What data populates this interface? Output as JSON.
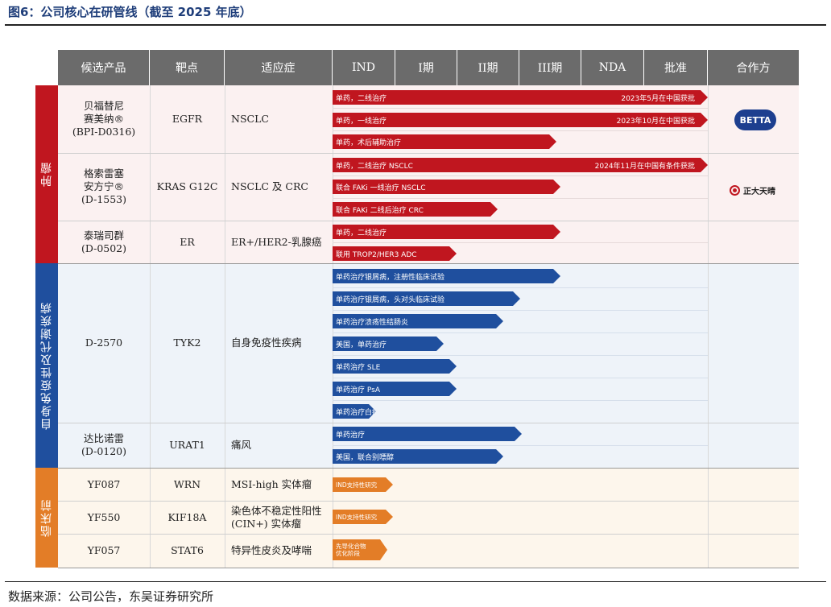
{
  "title": "图6：公司核心在研管线（截至 2025 年底）",
  "source": "数据来源：公司公告，东吴证券研究所",
  "headers": [
    "候选产品",
    "靶点",
    "适应症",
    "IND",
    "I期",
    "II期",
    "III期",
    "NDA",
    "批准",
    "合作方"
  ],
  "bands": {
    "oncology": "肿瘤",
    "autoimmune": "自身免疫性及代谢疾病",
    "preclinical": "临床前"
  },
  "colors": {
    "oncology": "#c0161f",
    "autoimmune": "#1f4f9e",
    "preclinical": "#e37d27"
  },
  "drugs": [
    {
      "name": "贝福替尼\n赛美纳®\n(BPI-D0316)",
      "target": "EGFR",
      "indication": "NSCLC"
    },
    {
      "name": "格索雷塞\n安方宁®\n(D-1553)",
      "target": "KRAS G12C",
      "indication": "NSCLC 及 CRC"
    },
    {
      "name": "泰瑞司群\n(D-0502)",
      "target": "ER",
      "indication": "ER+/HER2-乳腺癌"
    },
    {
      "name": "D-2570",
      "target": "TYK2",
      "indication": "自身免疫性疾病"
    },
    {
      "name": "达比诺雷\n(D-0120)",
      "target": "URAT1",
      "indication": "痛风"
    },
    {
      "name": "YF087",
      "target": "WRN",
      "indication": "MSI-high 实体瘤"
    },
    {
      "name": "YF550",
      "target": "KIF18A",
      "indication": "染色体不稳定性阳性\n(CIN+) 实体瘤"
    },
    {
      "name": "YF057",
      "target": "STAT6",
      "indication": "特异性皮炎及哮喘"
    }
  ],
  "bars": [
    {
      "label": "单药，二线治疗",
      "note": "2023年5月在中国获批",
      "color": "red"
    },
    {
      "label": "单药，一线治疗",
      "note": "2023年10月在中国获批",
      "color": "red"
    },
    {
      "label": "单药，术后辅助治疗",
      "note": "",
      "color": "red"
    },
    {
      "label": "单药，二线治疗 NSCLC",
      "note": "2024年11月在中国有条件获批",
      "color": "red"
    },
    {
      "label": "联合 FAKi 一线治疗 NSCLC",
      "note": "",
      "color": "red"
    },
    {
      "label": "联合 FAKi 二线后治疗 CRC",
      "note": "",
      "color": "red"
    },
    {
      "label": "单药，二线治疗",
      "note": "",
      "color": "red"
    },
    {
      "label": "联用 TROP2/HER3 ADC",
      "note": "",
      "color": "red"
    },
    {
      "label": "单药治疗银屑病，注册性临床试验",
      "note": "",
      "color": "blue"
    },
    {
      "label": "单药治疗银屑病，头对头临床试验",
      "note": "",
      "color": "blue"
    },
    {
      "label": "单药治疗溃疡性结肠炎",
      "note": "",
      "color": "blue"
    },
    {
      "label": "美国，单药治疗",
      "note": "",
      "color": "blue"
    },
    {
      "label": "单药治疗 SLE",
      "note": "",
      "color": "blue"
    },
    {
      "label": "单药治疗 PsA",
      "note": "",
      "color": "blue"
    },
    {
      "label": "单药治疗白癜风",
      "note": "",
      "color": "blue"
    },
    {
      "label": "单药治疗",
      "note": "",
      "color": "blue"
    },
    {
      "label": "美国，联合别嘌醇",
      "note": "",
      "color": "blue"
    },
    {
      "label": "IND支持性研究",
      "note": "",
      "color": "orange"
    },
    {
      "label": "IND支持性研究",
      "note": "",
      "color": "orange"
    },
    {
      "label": "先导化合物\n优化阶段",
      "note": "",
      "color": "orange"
    }
  ],
  "partners": {
    "betta": "BETTA",
    "ztt": "正大天晴"
  }
}
